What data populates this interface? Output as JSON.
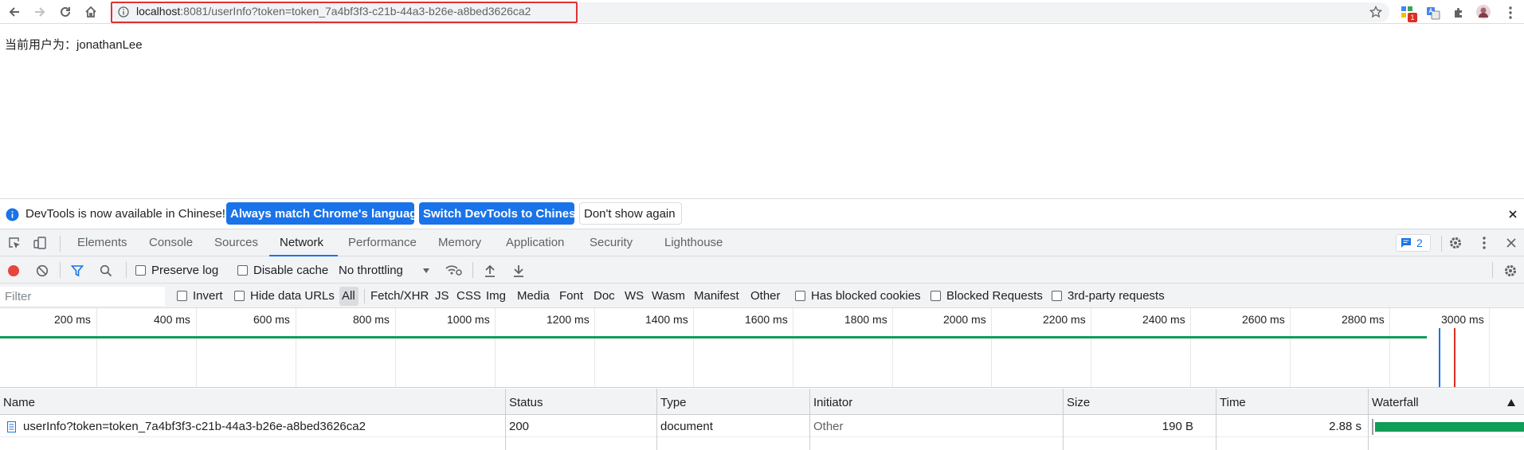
{
  "browser": {
    "url_host": "localhost",
    "url_rest": ":8081/userInfo?token=token_7a4bf3f3-c21b-44a3-b26e-a8bed3626ca2",
    "extension_badge": "1"
  },
  "page": {
    "label": "当前用户为：",
    "username": "jonathanLee"
  },
  "infobar": {
    "message": "DevTools is now available in Chinese!",
    "btn_match": "Always match Chrome's language",
    "btn_switch": "Switch DevTools to Chinese",
    "btn_dont": "Don't show again"
  },
  "devtools": {
    "tabs": [
      "Elements",
      "Console",
      "Sources",
      "Network",
      "Performance",
      "Memory",
      "Application",
      "Security",
      "Lighthouse"
    ],
    "active_tab": "Network",
    "issues_count": "2"
  },
  "network_toolbar": {
    "preserve_log": "Preserve log",
    "disable_cache": "Disable cache",
    "throttling": "No throttling"
  },
  "filter_bar": {
    "placeholder": "Filter",
    "invert": "Invert",
    "hide_data_urls": "Hide data URLs",
    "types": [
      "All",
      "Fetch/XHR",
      "JS",
      "CSS",
      "Img",
      "Media",
      "Font",
      "Doc",
      "WS",
      "Wasm",
      "Manifest",
      "Other"
    ],
    "active_type": "All",
    "has_blocked_cookies": "Has blocked cookies",
    "blocked_requests": "Blocked Requests",
    "third_party": "3rd-party requests"
  },
  "overview": {
    "ticks": [
      "200 ms",
      "400 ms",
      "600 ms",
      "800 ms",
      "1000 ms",
      "1200 ms",
      "1400 ms",
      "1600 ms",
      "1800 ms",
      "2000 ms",
      "2200 ms",
      "2400 ms",
      "2600 ms",
      "2800 ms",
      "3000 ms"
    ]
  },
  "table": {
    "headers": [
      "Name",
      "Status",
      "Type",
      "Initiator",
      "Size",
      "Time",
      "Waterfall"
    ],
    "rows": [
      {
        "name": "userInfo?token=token_7a4bf3f3-c21b-44a3-b26e-a8bed3626ca2",
        "status": "200",
        "type": "document",
        "initiator": "Other",
        "size": "190 B",
        "time": "2.88 s"
      }
    ]
  },
  "colors": {
    "accent": "#1a73e8",
    "record": "#e8453c",
    "waterfall": "#0f9d58",
    "highlight": "#e03131"
  }
}
